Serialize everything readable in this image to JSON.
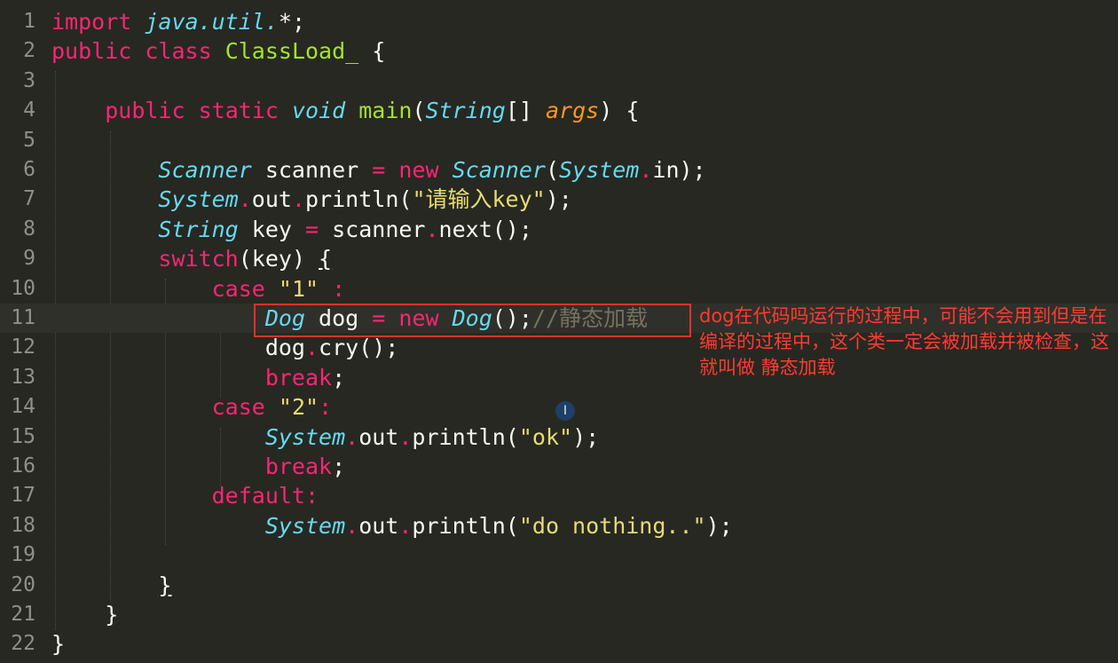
{
  "editor": {
    "current_line": 11,
    "line_numbers": [
      "1",
      "2",
      "3",
      "4",
      "5",
      "6",
      "7",
      "8",
      "9",
      "10",
      "11",
      "12",
      "13",
      "14",
      "15",
      "16",
      "17",
      "18",
      "19",
      "20",
      "21",
      "22"
    ],
    "code": {
      "l1_import": "import",
      "l1_pkg": "java.util.",
      "l1_rest": "*;",
      "l2_public": "public",
      "l2_class": "class",
      "l2_name": "ClassLoad_",
      "l2_brace": "{",
      "l4_public": "public",
      "l4_static": "static",
      "l4_void": "void",
      "l4_main": "main",
      "l4_paren": "(",
      "l4_string": "String",
      "l4_arr": "[] ",
      "l4_args": "args",
      "l4_end": ") {",
      "l6_type": "Scanner",
      "l6_var": " scanner ",
      "l6_eq": "=",
      "l6_new": "new",
      "l6_ctor": "Scanner",
      "l6_p1": "(",
      "l6_system": "System",
      "l6_dot": ".",
      "l6_in": "in);",
      "l7_system": "System",
      "l7_dot1": ".",
      "l7_out": "out",
      "l7_dot2": ".",
      "l7_println": "println(",
      "l7_str": "\"请输入key\"",
      "l7_end": ");",
      "l8_type": "String",
      "l8_var": " key ",
      "l8_eq": "=",
      "l8_scanner": " scanner",
      "l8_dot": ".",
      "l8_next": "next();",
      "l9_switch": "switch",
      "l9_mid": "(key) ",
      "l9_brace": "{",
      "l10_case": "case",
      "l10_str": "\"1\"",
      "l10_colon": ":",
      "l11_type": "Dog",
      "l11_var": " dog ",
      "l11_eq": "=",
      "l11_new": "new",
      "l11_ctor": "Dog",
      "l11_end": "();",
      "l11_comment": "//静态加载",
      "l12_dog": "dog",
      "l12_dot": ".",
      "l12_cry": "cry();",
      "l13_break": "break",
      "l13_semi": ";",
      "l14_case": "case",
      "l14_str": "\"2\"",
      "l14_colon": ":",
      "l15_system": "System",
      "l15_dot1": ".",
      "l15_out": "out",
      "l15_dot2": ".",
      "l15_println": "println(",
      "l15_str": "\"ok\"",
      "l15_end": ");",
      "l16_break": "break",
      "l16_semi": ";",
      "l17_default": "default",
      "l17_colon": ":",
      "l18_system": "System",
      "l18_dot1": ".",
      "l18_out": "out",
      "l18_dot2": ".",
      "l18_println": "println(",
      "l18_str": "\"do nothing..\"",
      "l18_end": ");",
      "l20_brace": "}",
      "l21_brace": "}",
      "l22_brace": "}"
    }
  },
  "annotation": {
    "text": "dog在代码吗运行的过程中，可能不会用到但是在编译的过程中，这个类一定会被加载并被检查，这就叫做 静态加载",
    "color": "#ff3b30",
    "box_color": "#e8312c"
  },
  "cursor": {
    "icon": "text-cursor-icon",
    "glyph": "I"
  }
}
